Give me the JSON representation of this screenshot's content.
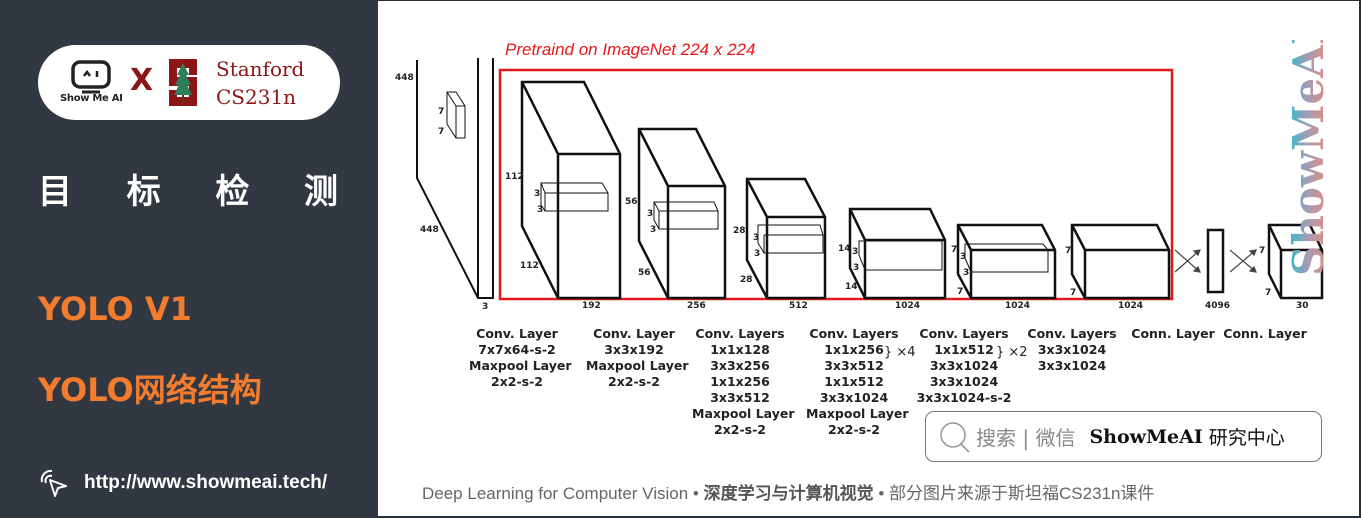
{
  "sidebar": {
    "brand_text": "Show Me AI",
    "cross": "X",
    "partner_line1": "Stanford",
    "partner_line2": "CS231n",
    "title_chars": [
      "目",
      "标",
      "检",
      "测"
    ],
    "subtitle1": "YOLO V1",
    "subtitle2": "YOLO网络结构",
    "url": "http://www.showmeai.tech/",
    "colors": {
      "background": "#323841",
      "accent": "#f47c2f",
      "stanford": "#8c1515"
    }
  },
  "diagram": {
    "pretrain_label": "Pretraind on ImageNet 224 x 224",
    "input": {
      "height": "448",
      "width": "448",
      "depth": "3",
      "kernel_h": "7",
      "kernel_w": "7"
    },
    "blocks": [
      {
        "h": "112",
        "w": "112",
        "depth": "192",
        "kh": "3",
        "kw": "3"
      },
      {
        "h": "56",
        "w": "56",
        "depth": "256",
        "kh": "3",
        "kw": "3"
      },
      {
        "h": "28",
        "w": "28",
        "depth": "512",
        "kh": "3",
        "kw": "3"
      },
      {
        "h": "14",
        "w": "14",
        "depth": "1024",
        "kh": "3",
        "kw": "3"
      },
      {
        "h": "7",
        "w": "7",
        "depth": "1024",
        "kh": "3",
        "kw": "3"
      },
      {
        "h": "7",
        "w": "7",
        "depth": "1024"
      }
    ],
    "fc_depth": "4096",
    "output": {
      "h": "7",
      "w": "7",
      "depth": "30"
    },
    "layer_labels": [
      [
        "Conv. Layer",
        "7x7x64-s-2",
        "Maxpool Layer",
        "2x2-s-2"
      ],
      [
        "Conv. Layer",
        "3x3x192",
        "Maxpool Layer",
        "2x2-s-2"
      ],
      [
        "Conv. Layers",
        "1x1x128",
        "3x3x256",
        "1x1x256",
        "3x3x512",
        "Maxpool Layer",
        "2x2-s-2"
      ],
      [
        "Conv. Layers",
        "1x1x256",
        "3x3x512",
        "1x1x512",
        "3x3x1024",
        "Maxpool Layer",
        "2x2-s-2"
      ],
      [
        "Conv. Layers",
        "1x1x512",
        "3x3x1024",
        "3x3x1024",
        "3x3x1024-s-2"
      ],
      [
        "Conv. Layers",
        "3x3x1024",
        "3x3x1024"
      ],
      [
        "Conn. Layer"
      ],
      [
        "Conn. Layer"
      ]
    ],
    "repeat_labels": [
      "×4",
      "×2"
    ]
  },
  "search": {
    "placeholder": "搜索 | 微信",
    "brand": "ShowMeAI",
    "brand_suffix": "研究中心"
  },
  "watermark": "ShowMeAI",
  "footer": {
    "part1": "Deep Learning for Computer Vision",
    "sep": " • ",
    "part2": "深度学习与计算机视觉",
    "part3": "部分图片来源于斯坦福CS231n课件"
  }
}
